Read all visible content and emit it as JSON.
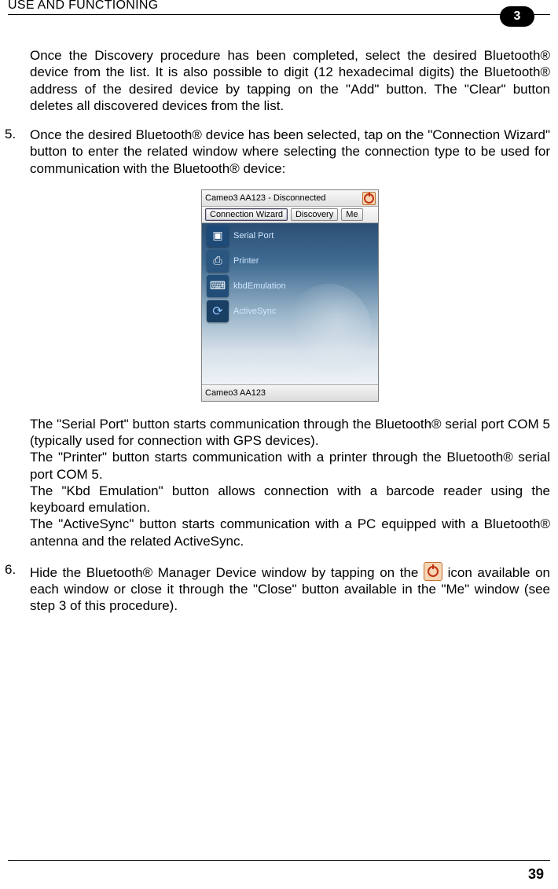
{
  "header": {
    "title": "USE AND FUNCTIONING",
    "chapter_badge": "3"
  },
  "intro_paragraph": "Once the Discovery procedure has been completed, select the desired Bluetooth® device from the list. It is also possible to digit (12 hexadecimal digits) the Bluetooth®  address of the desired device by tapping on the \"Add\" button. The \"Clear\" button deletes all discovered devices from the list.",
  "steps": {
    "five": {
      "num": "5.",
      "text": "Once the desired Bluetooth® device has been selected, tap on the \"Connection Wizard\" button to enter the related window where selecting the connection type to be used for communication with the Bluetooth® device:"
    },
    "six": {
      "num": "6.",
      "text_before_icon": "Hide the Bluetooth® Manager Device window by tapping on the ",
      "text_after_icon": " icon available on each window or close it through the \"Close\" button available in the \"Me\" window (see step 3 of this procedure)."
    }
  },
  "screenshot": {
    "titlebar": "Cameo3 AA123 - Disconnected",
    "tabs": {
      "connection_wizard": "Connection Wizard",
      "discovery": "Discovery",
      "me": "Me"
    },
    "items": {
      "serial_port": "Serial Port",
      "printer": "Printer",
      "kbd_emulation": "kbdEmulation",
      "activesync": "ActiveSync"
    },
    "statusbar": "Cameo3 AA123"
  },
  "after_shot_paragraphs": {
    "p1": "The \"Serial Port\" button starts communication through the Bluetooth® serial port COM 5 (typically used for connection with GPS devices).",
    "p2": "The \"Printer\" button starts communication with a printer through the Bluetooth® serial port COM 5.",
    "p3": "The \"Kbd Emulation\" button allows connection with a barcode reader using the keyboard emulation.",
    "p4": "The \"ActiveSync\" button starts communication with a PC equipped with a Bluetooth® antenna and the related ActiveSync."
  },
  "page_number": "39"
}
